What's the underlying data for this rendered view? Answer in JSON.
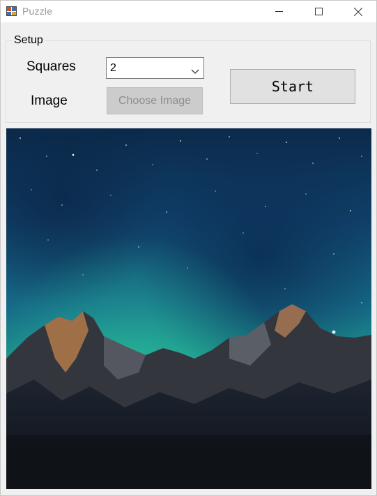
{
  "window": {
    "title": "Puzzle",
    "icon": "puzzle-app-icon",
    "controls": [
      "minimize-icon",
      "maximize-icon",
      "close-icon"
    ]
  },
  "setup": {
    "group_label": "Setup",
    "squares_label": "Squares",
    "squares_value": "2",
    "image_label": "Image",
    "choose_image_label": "Choose Image",
    "choose_image_enabled": false,
    "start_label": "Start"
  },
  "picture": {
    "subject": "starry night sky with aurora over mountain peaks",
    "colors": {
      "sky_top": "#0e2a4a",
      "sky_glow": "#1fa08c",
      "mountains": "#1a1e26"
    }
  }
}
